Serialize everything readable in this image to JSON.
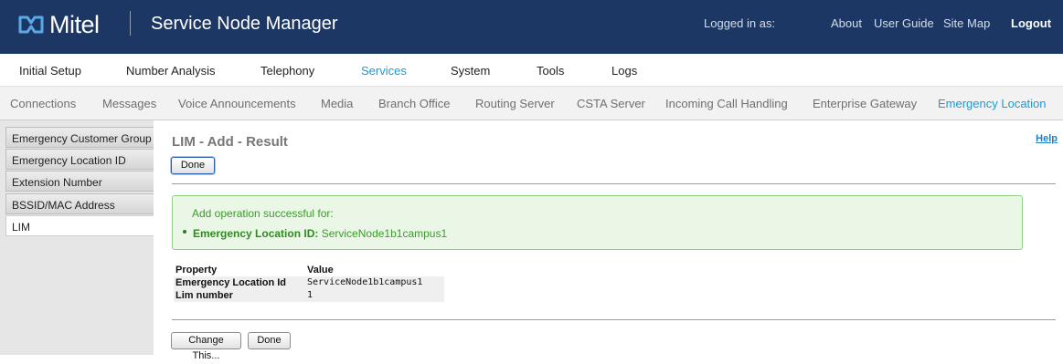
{
  "header": {
    "logo_text": "Mitel",
    "app_title": "Service Node Manager",
    "logged_in": "Logged in as:",
    "links": [
      "About",
      "User Guide",
      "Site Map"
    ],
    "logout": "Logout"
  },
  "main_nav": [
    "Initial Setup",
    "Number Analysis",
    "Telephony",
    "Services",
    "System",
    "Tools",
    "Logs"
  ],
  "main_nav_active": "Services",
  "sub_nav": [
    "Connections",
    "Messages",
    "Voice Announcements",
    "Media",
    "Branch Office",
    "Routing Server",
    "CSTA Server",
    "Incoming Call Handling",
    "Enterprise Gateway",
    "Emergency Location"
  ],
  "sub_nav_active": "Emergency Location",
  "sidebar": [
    "Emergency Customer Group",
    "Emergency Location ID",
    "Extension Number",
    "BSSID/MAC Address",
    "LIM"
  ],
  "sidebar_active": "LIM",
  "page": {
    "title": "LIM - Add - Result",
    "help": "Help",
    "done_button": "Done",
    "success_message": "Add operation successful for:",
    "success_item_label": "Emergency Location ID:",
    "success_item_value": "ServiceNode1b1campus1",
    "table_headers": [
      "Property",
      "Value"
    ],
    "rows": [
      {
        "property": "Emergency Location Id",
        "value": "ServiceNode1b1campus1"
      },
      {
        "property": "Lim number",
        "value": "1"
      }
    ],
    "change_button": "Change This...",
    "done_button_bottom": "Done"
  },
  "colors": {
    "header_bg": "#1c3763",
    "accent": "#1a9ad7",
    "success_bg": "#eaf7e6",
    "success_text": "#3c9a2d"
  }
}
